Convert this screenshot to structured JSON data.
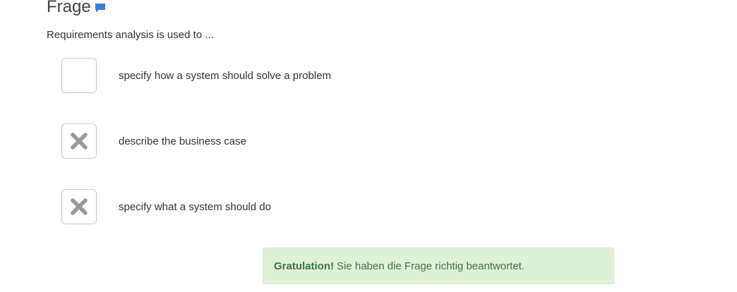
{
  "header": {
    "title": "Frage",
    "comment_icon": "comment-icon",
    "comment_icon_color": "#3a7bd5"
  },
  "question": {
    "text": "Requirements analysis is used to ..."
  },
  "answers": [
    {
      "label": "specify how a system should solve a problem",
      "mark": "",
      "mark_icon": "none"
    },
    {
      "label": "describe the business case",
      "mark": "✗",
      "mark_icon": "x-mark-icon"
    },
    {
      "label": "specify what a system should do",
      "mark": "✗",
      "mark_icon": "x-mark-icon"
    }
  ],
  "feedback": {
    "strong": "Gratulation!",
    "text": "Sie haben die Frage richtig beantwortet.",
    "background_color": "#dff0d8",
    "text_color": "#3c763d"
  },
  "colors": {
    "mark_color": "#999999",
    "checkbox_border": "#cccccc"
  }
}
